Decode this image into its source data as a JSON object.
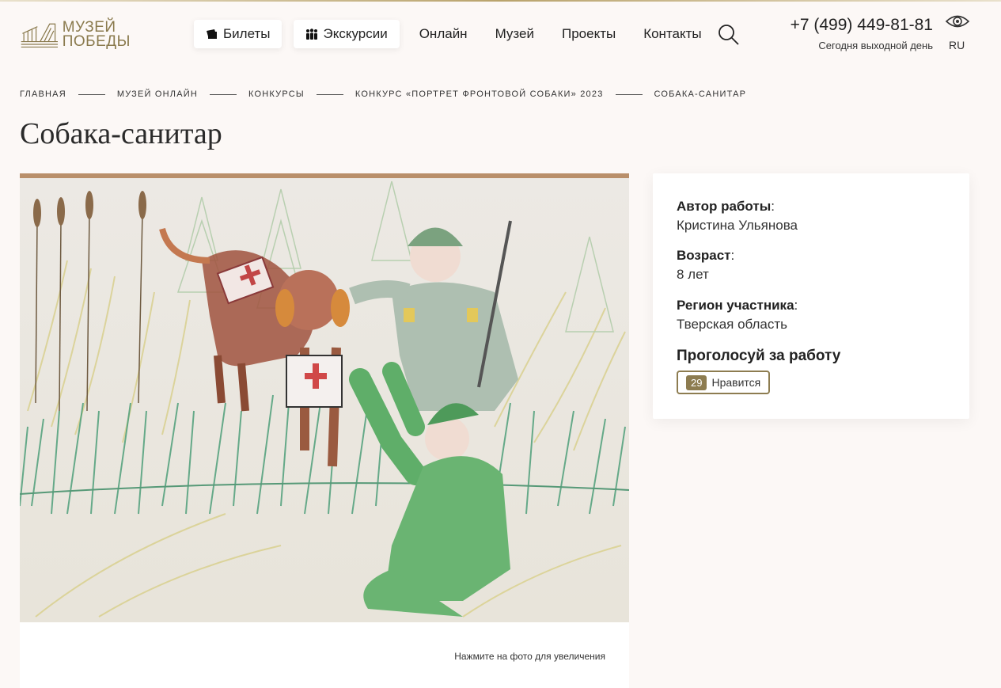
{
  "header": {
    "logo_line1": "МУЗЕЙ",
    "logo_line2": "ПОБЕДЫ",
    "tickets_label": "Билеты",
    "excursions_label": "Экскурсии",
    "nav": [
      "Онлайн",
      "Музей",
      "Проекты",
      "Контакты"
    ],
    "phone": "+7 (499) 449-81-81",
    "schedule_note": "Сегодня выходной день",
    "language": "RU"
  },
  "breadcrumb": [
    "ГЛАВНАЯ",
    "МУЗЕЙ ОНЛАЙН",
    "КОНКУРСЫ",
    "КОНКУРС «ПОРТРЕТ ФРОНТОВОЙ СОБАКИ» 2023",
    "СОБАКА-САНИТАР"
  ],
  "page_title": "Собака-санитар",
  "picture": {
    "hint": "Нажмите на фото для увеличения"
  },
  "info": {
    "author_label": "Автор работы",
    "author_value": "Кристина Ульянова",
    "age_label": "Возраст",
    "age_value": "8 лет",
    "region_label": "Регион участника",
    "region_value": "Тверская область",
    "vote_title": "Проголосуй за работу",
    "likes_count": "29",
    "like_label": "Нравится"
  },
  "colors": {
    "accent": "#8d7c50",
    "background": "#fcf8f6"
  }
}
